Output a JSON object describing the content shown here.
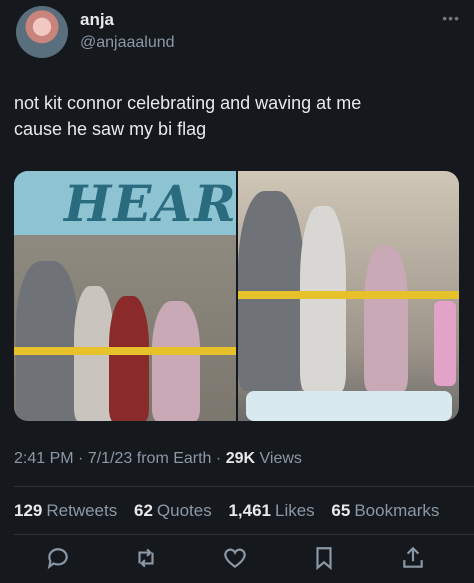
{
  "author": {
    "name": "anja",
    "handle": "@anjaaalund"
  },
  "tweet": {
    "text": "not kit connor celebrating and waving at me\ncause he saw my bi flag"
  },
  "media": {
    "banner_text": "HEART"
  },
  "meta": {
    "time": "2:41 PM",
    "date": "7/1/23",
    "source": "from Earth",
    "views_count": "29K",
    "views_label": "Views",
    "sep": "·"
  },
  "stats": {
    "retweets_count": "129",
    "retweets_label": "Retweets",
    "quotes_count": "62",
    "quotes_label": "Quotes",
    "likes_count": "1,461",
    "likes_label": "Likes",
    "bookmarks_count": "65",
    "bookmarks_label": "Bookmarks"
  },
  "icons": {
    "reply": "reply-icon",
    "retweet": "retweet-icon",
    "like": "heart-icon",
    "bookmark": "bookmark-icon",
    "share": "share-icon",
    "more": "more-icon"
  },
  "colors": {
    "background": "#15181d",
    "text": "#e7e9ea",
    "muted": "#8b98a5"
  }
}
